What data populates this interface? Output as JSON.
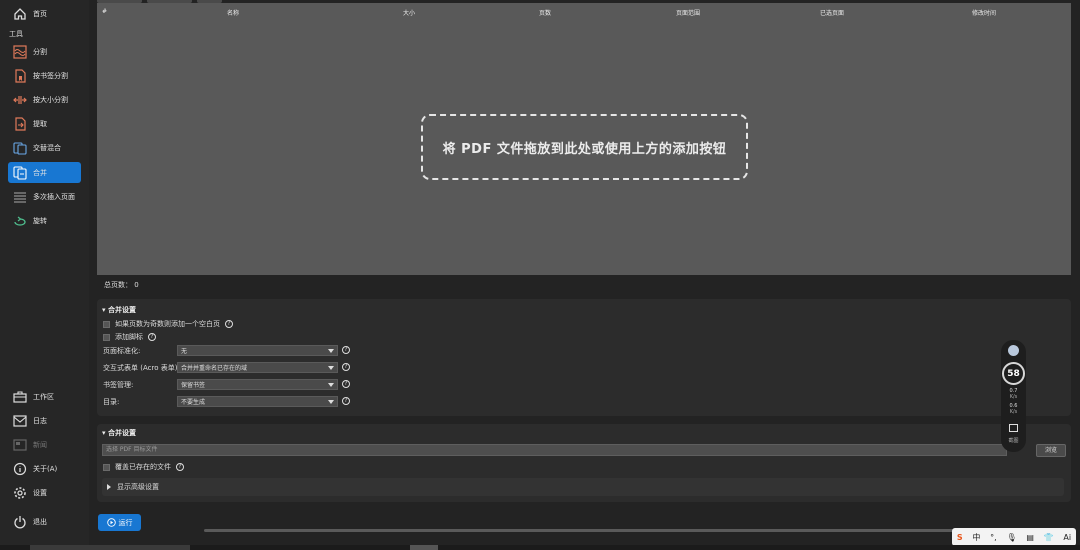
{
  "sidebar": {
    "home": "首页",
    "section_tools": "工具",
    "tools": [
      {
        "label": "分割",
        "icon": "split-wave-icon"
      },
      {
        "label": "按书签分割",
        "icon": "bookmark-split-icon"
      },
      {
        "label": "按大小分割",
        "icon": "size-split-icon"
      },
      {
        "label": "提取",
        "icon": "extract-icon"
      },
      {
        "label": "交替混合",
        "icon": "alternate-mix-icon"
      },
      {
        "label": "合并",
        "icon": "merge-icon"
      },
      {
        "label": "多次插入页面",
        "icon": "insert-pages-icon"
      },
      {
        "label": "旋转",
        "icon": "rotate-icon"
      }
    ],
    "bottom": [
      {
        "label": "工作区",
        "icon": "workspace-icon"
      },
      {
        "label": "日志",
        "icon": "log-icon"
      },
      {
        "label": "新闻",
        "icon": "news-icon"
      },
      {
        "label": "关于(A)",
        "icon": "info-icon"
      },
      {
        "label": "设置",
        "icon": "gear-icon"
      },
      {
        "label": "退出",
        "icon": "power-icon"
      }
    ]
  },
  "table": {
    "columns": [
      "#",
      "名称",
      "大小",
      "页数",
      "页面范围",
      "已选页面",
      "修改时间"
    ],
    "drop_hint": "将 PDF 文件拖放到此处或使用上方的添加按钮",
    "total_pages": "总页数： 0"
  },
  "merge_settings": {
    "title": "合并设置",
    "blank_page_checkbox": "如果页数为奇数则添加一个空白页",
    "footer_checkbox": "添加脚标",
    "fields": [
      {
        "label": "页面标准化:",
        "value": "无"
      },
      {
        "label": "交互式表单 (Acro 表单):",
        "value": "合并并重命名已存在的域"
      },
      {
        "label": "书签管理:",
        "value": "保留书签"
      },
      {
        "label": "目录:",
        "value": "不要生成"
      }
    ]
  },
  "output_settings": {
    "title": "合并设置",
    "path_placeholder": "选择 PDF 目标文件",
    "browse_label": "浏览",
    "overwrite_checkbox": "覆盖已存在的文件",
    "advanced_label": "显示高级设置"
  },
  "run_label": "运行",
  "widget": {
    "gauge": "58",
    "upload": "0.7",
    "upload_unit": "K/s",
    "download": "0.6",
    "download_unit": "K/s",
    "bottom_label": "截图"
  },
  "ime": {
    "logo": "S",
    "lang": "中",
    "punct": "°,",
    "ai": "Ai"
  }
}
